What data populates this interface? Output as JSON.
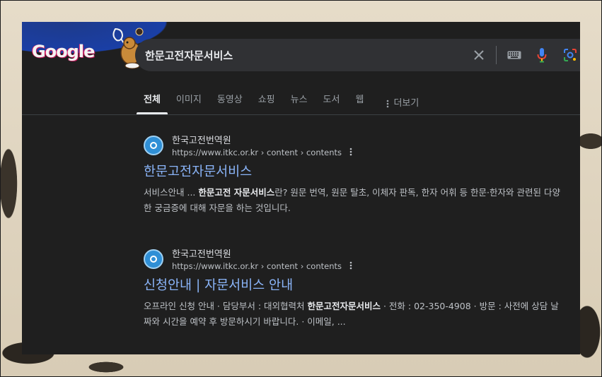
{
  "search": {
    "query": "한문고전자문서비스",
    "logo_text": "Google"
  },
  "tabs": [
    {
      "label": "전체",
      "active": true
    },
    {
      "label": "이미지",
      "active": false
    },
    {
      "label": "동영상",
      "active": false
    },
    {
      "label": "쇼핑",
      "active": false
    },
    {
      "label": "뉴스",
      "active": false
    },
    {
      "label": "도서",
      "active": false
    },
    {
      "label": "웹",
      "active": false
    }
  ],
  "more_label": "더보기",
  "results": [
    {
      "site_name": "한국고전번역원",
      "url": "https://www.itkc.or.kr › content › contents",
      "title": "한문고전자문서비스",
      "snippet_parts": [
        {
          "text": "서비스안내 ... ",
          "bold": false
        },
        {
          "text": "한문고전 자문서비스",
          "bold": true
        },
        {
          "text": "란? 원문 번역, 원문 탈초, 이체자 판독, 한자 어휘 등 한문·한자와 관련된 다양한 궁금증에 대해 자문을 하는 것입니다.",
          "bold": false
        }
      ]
    },
    {
      "site_name": "한국고전번역원",
      "url": "https://www.itkc.or.kr › content › contents",
      "title": "신청안내 | 자문서비스 안내",
      "snippet_parts": [
        {
          "text": "오프라인 신청 안내 · 담당부서 : 대외협력처 ",
          "bold": false
        },
        {
          "text": "한문고전자문서비스",
          "bold": true
        },
        {
          "text": " · 전화 : 02-350-4908 · 방문 : 사전에 상담 날짜와 시간을 예약 후 방문하시기 바랍니다. · 이메일, ...",
          "bold": false
        }
      ]
    }
  ],
  "icons": {
    "clear": "close-icon",
    "keyboard": "keyboard-icon",
    "voice": "microphone-icon",
    "lens": "camera-icon",
    "more": "kebab-icon"
  },
  "colors": {
    "background": "#1f1f1f",
    "link": "#8ab4f8",
    "favicon": "#2f8fd6"
  }
}
